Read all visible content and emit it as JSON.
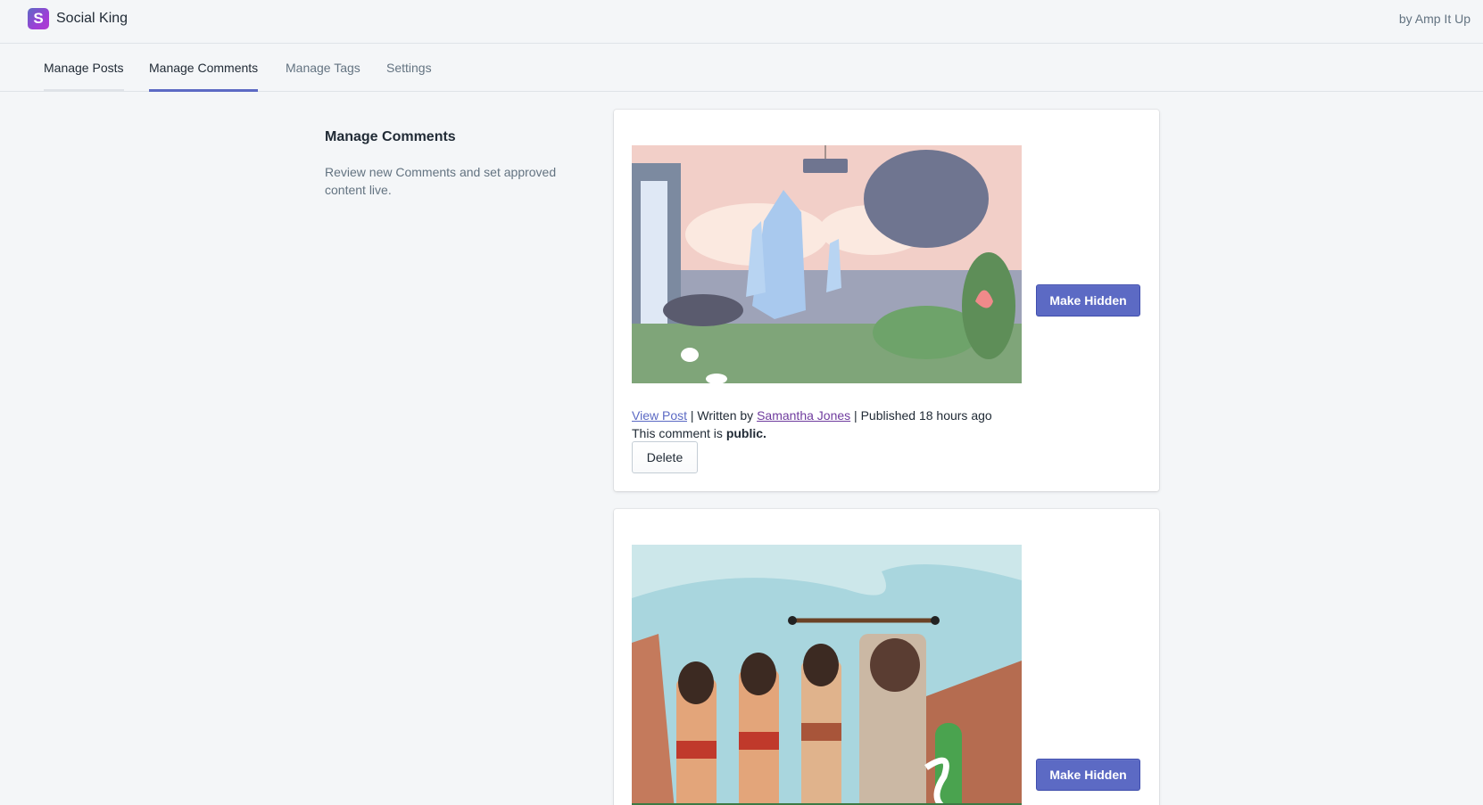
{
  "app": {
    "name": "Social King",
    "logo_letter": "S",
    "byline": "by Amp It Up"
  },
  "tabs": [
    {
      "label": "Manage Posts"
    },
    {
      "label": "Manage Comments",
      "active": true
    },
    {
      "label": "Manage Tags"
    },
    {
      "label": "Settings"
    }
  ],
  "section": {
    "title": "Manage Comments",
    "description": "Review new Comments and set approved content live."
  },
  "comments": [
    {
      "image": "crystal-landscape-illustration",
      "view_post": "View Post",
      "written_by_prefix": " | Written by ",
      "author": "Samantha Jones",
      "published": " | Published 18 hours ago",
      "status_prefix": "This comment is ",
      "status": "public.",
      "make_hidden": "Make Hidden",
      "delete": "Delete"
    },
    {
      "image": "native-warriors-illustration",
      "make_hidden": "Make Hidden"
    }
  ],
  "colors": {
    "accent": "#5c6ac4",
    "background": "#f4f6f8",
    "text_subdued": "#637381"
  }
}
